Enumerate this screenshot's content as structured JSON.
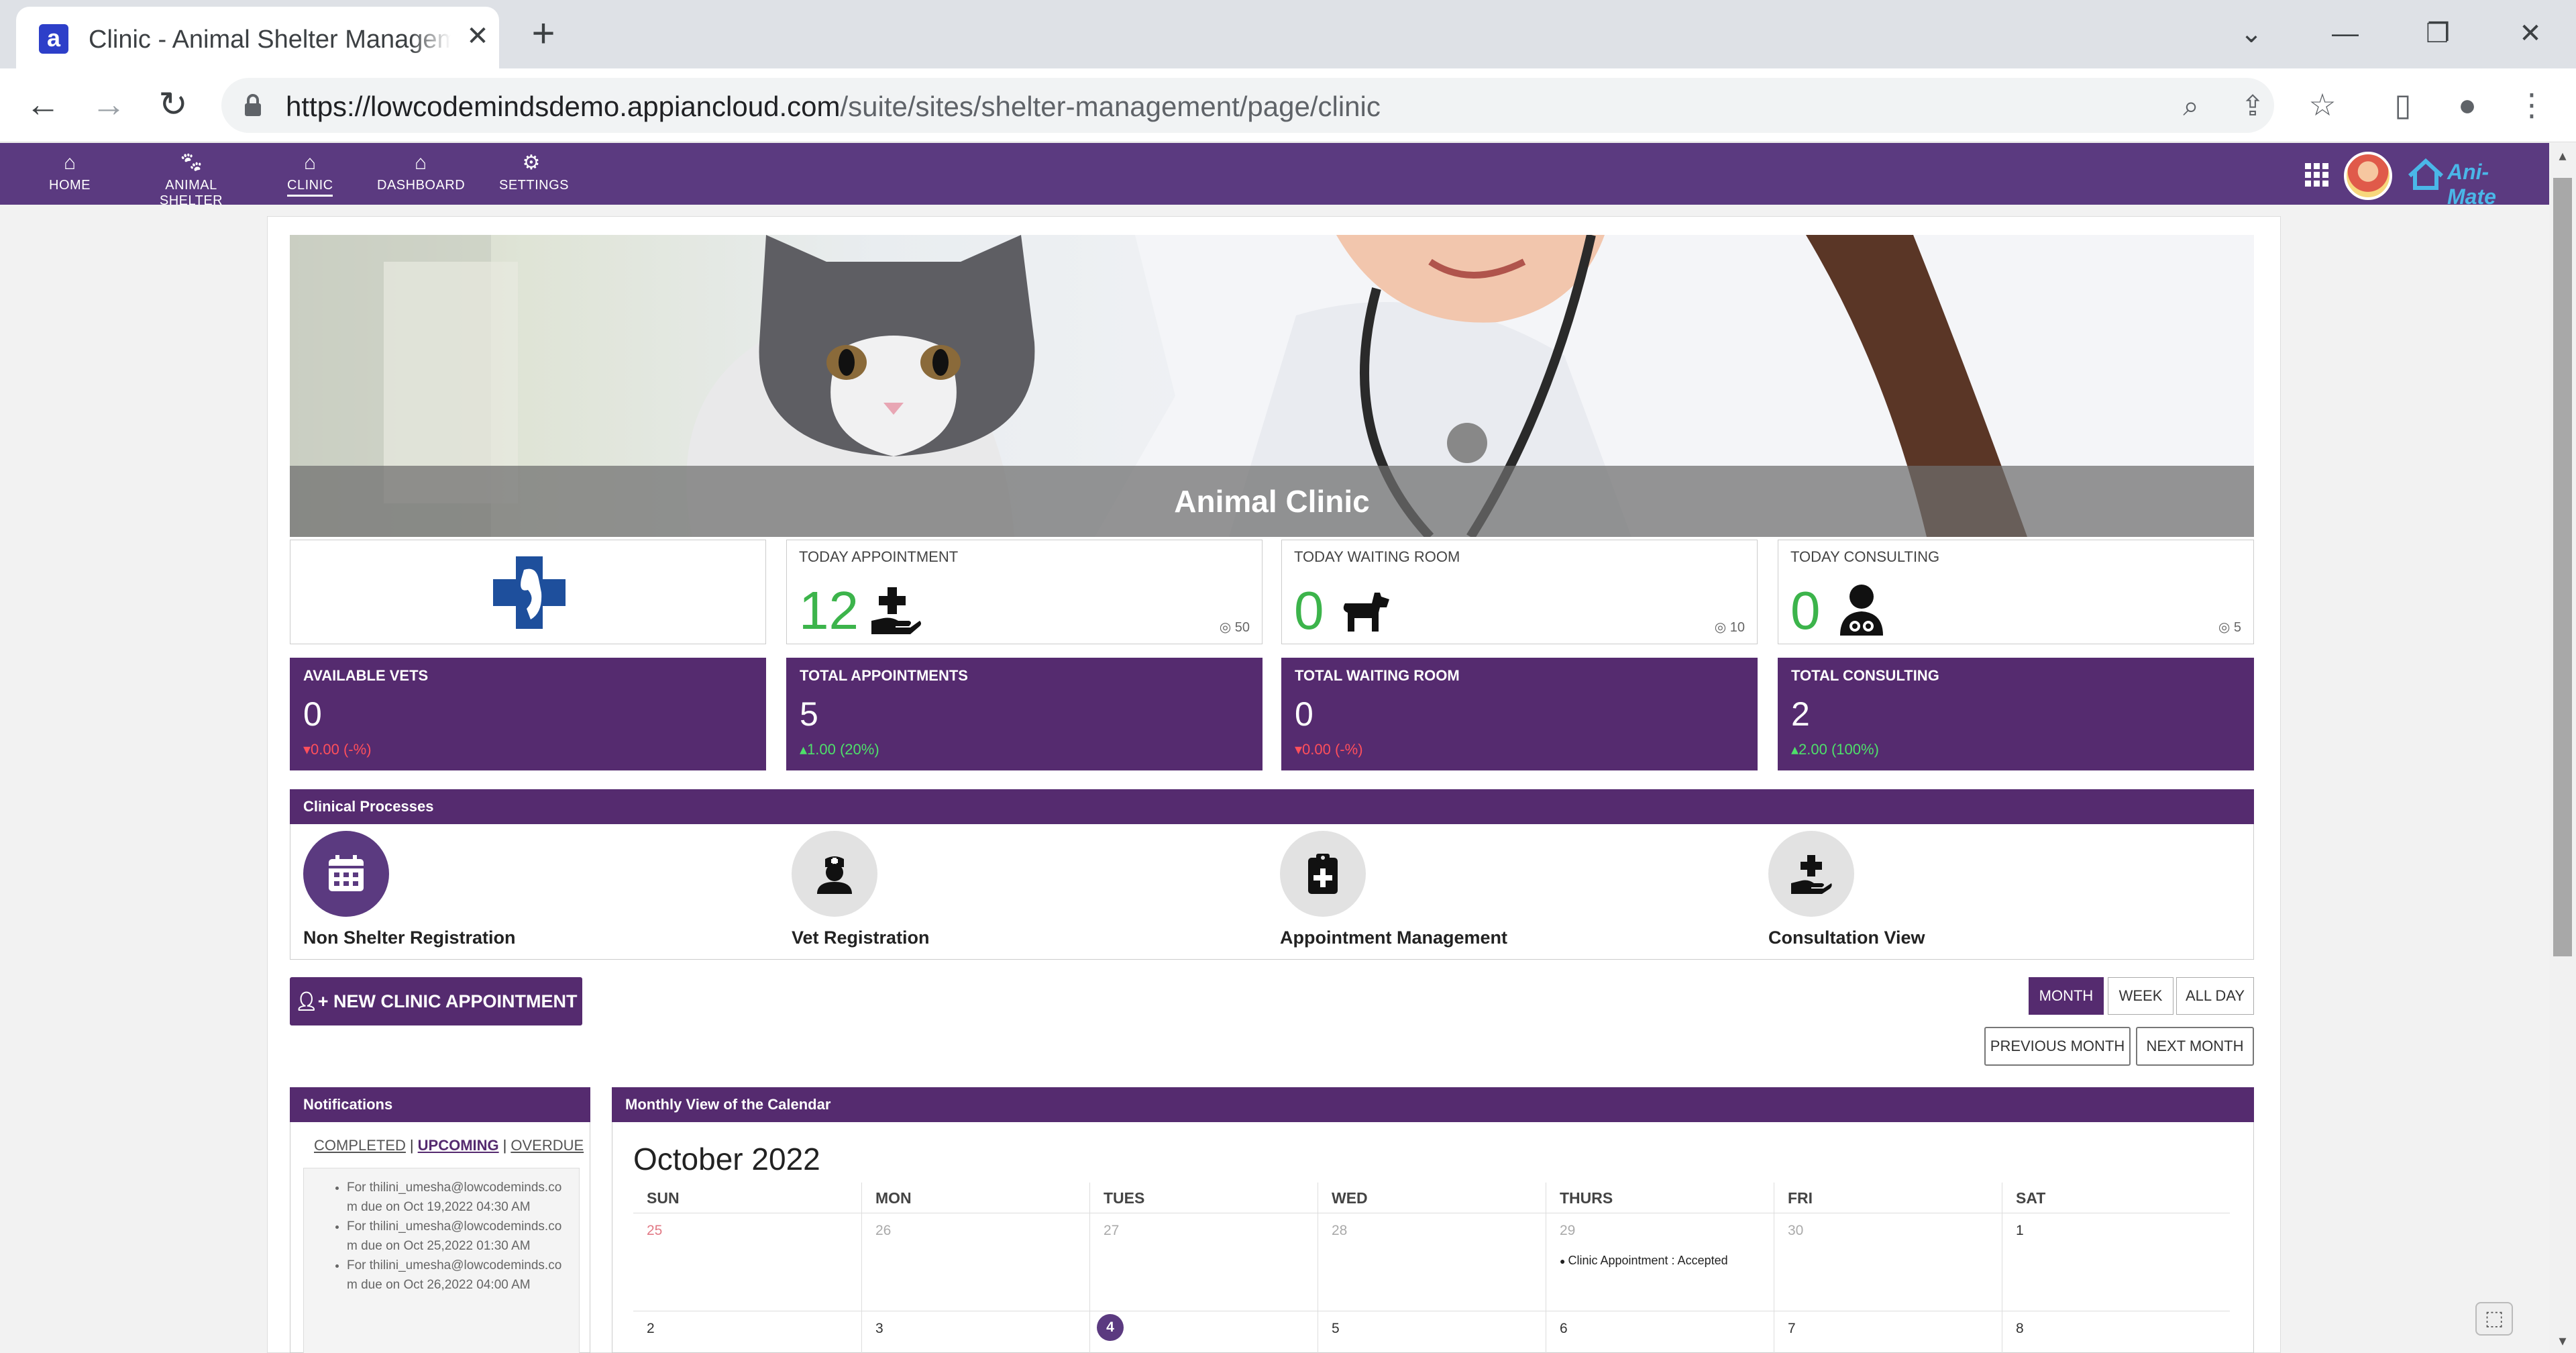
{
  "browser": {
    "tab_title": "Clinic - Animal Shelter Management",
    "tab_favicon": "a",
    "url_host": "https://lowcodemindsdemo.appiancloud.com",
    "url_path": "/suite/sites/shelter-management/page/clinic"
  },
  "nav": {
    "items": [
      {
        "label": "HOME",
        "icon": "home-icon"
      },
      {
        "label": "ANIMAL SHELTER",
        "icon": "paw-icon"
      },
      {
        "label": "CLINIC",
        "icon": "clinic-icon",
        "active": true
      },
      {
        "label": "DASHBOARD",
        "icon": "dashboard-icon"
      },
      {
        "label": "SETTINGS",
        "icon": "gear-icon"
      }
    ],
    "logo_text": "Ani-Mate"
  },
  "banner": {
    "caption": "Animal Clinic"
  },
  "kpis": [
    {
      "title": "TODAY APPOINTMENT",
      "value": "12",
      "count": "50",
      "icon": "hand-plus-icon"
    },
    {
      "title": "TODAY WAITING ROOM",
      "value": "0",
      "count": "10",
      "icon": "dog-icon"
    },
    {
      "title": "TODAY CONSULTING",
      "value": "0",
      "count": "5",
      "icon": "doctor-icon"
    }
  ],
  "stats": [
    {
      "title": "AVAILABLE VETS",
      "value": "0",
      "delta": "0.00 (-%)",
      "direction": "down"
    },
    {
      "title": "TOTAL APPOINTMENTS",
      "value": "5",
      "delta": "1.00 (20%)",
      "direction": "up"
    },
    {
      "title": "TOTAL WAITING ROOM",
      "value": "0",
      "delta": "0.00 (-%)",
      "direction": "down"
    },
    {
      "title": "TOTAL CONSULTING",
      "value": "2",
      "delta": "2.00 (100%)",
      "direction": "up"
    }
  ],
  "processes": {
    "title": "Clinical Processes",
    "items": [
      {
        "label": "Non Shelter Registration",
        "icon": "calendar-icon",
        "active": true
      },
      {
        "label": "Vet Registration",
        "icon": "nurse-icon"
      },
      {
        "label": "Appointment Management",
        "icon": "clipboard-plus-icon"
      },
      {
        "label": "Consultation View",
        "icon": "hand-plus-icon"
      }
    ]
  },
  "actions": {
    "new_appointment": "NEW CLINIC APPOINTMENT",
    "view_month": "MONTH",
    "view_week": "WEEK",
    "view_all_day": "ALL DAY",
    "previous_month": "PREVIOUS MONTH",
    "next_month": "NEXT MONTH"
  },
  "notifications": {
    "title": "Notifications",
    "tabs": [
      "COMPLETED",
      "UPCOMING",
      "OVERDUE"
    ],
    "selected_tab": "UPCOMING",
    "items": [
      "For thilini_umesha@lowcodeminds.com due on Oct 19,2022 04:30 AM",
      "For thilini_umesha@lowcodeminds.com due on Oct 25,2022 01:30 AM",
      "For thilini_umesha@lowcodeminds.com due on Oct 26,2022 04:00 AM"
    ]
  },
  "calendar": {
    "section_title": "Monthly View of the Calendar",
    "month_title": "October 2022",
    "weekdays": [
      "SUN",
      "MON",
      "TUES",
      "WED",
      "THURS",
      "FRI",
      "SAT"
    ],
    "week1": [
      "25",
      "26",
      "27",
      "28",
      "29",
      "30",
      "1"
    ],
    "week2": [
      "2",
      "3",
      "4",
      "5",
      "6",
      "7",
      "8"
    ],
    "event_label": "Clinic Appointment : Accepted"
  }
}
